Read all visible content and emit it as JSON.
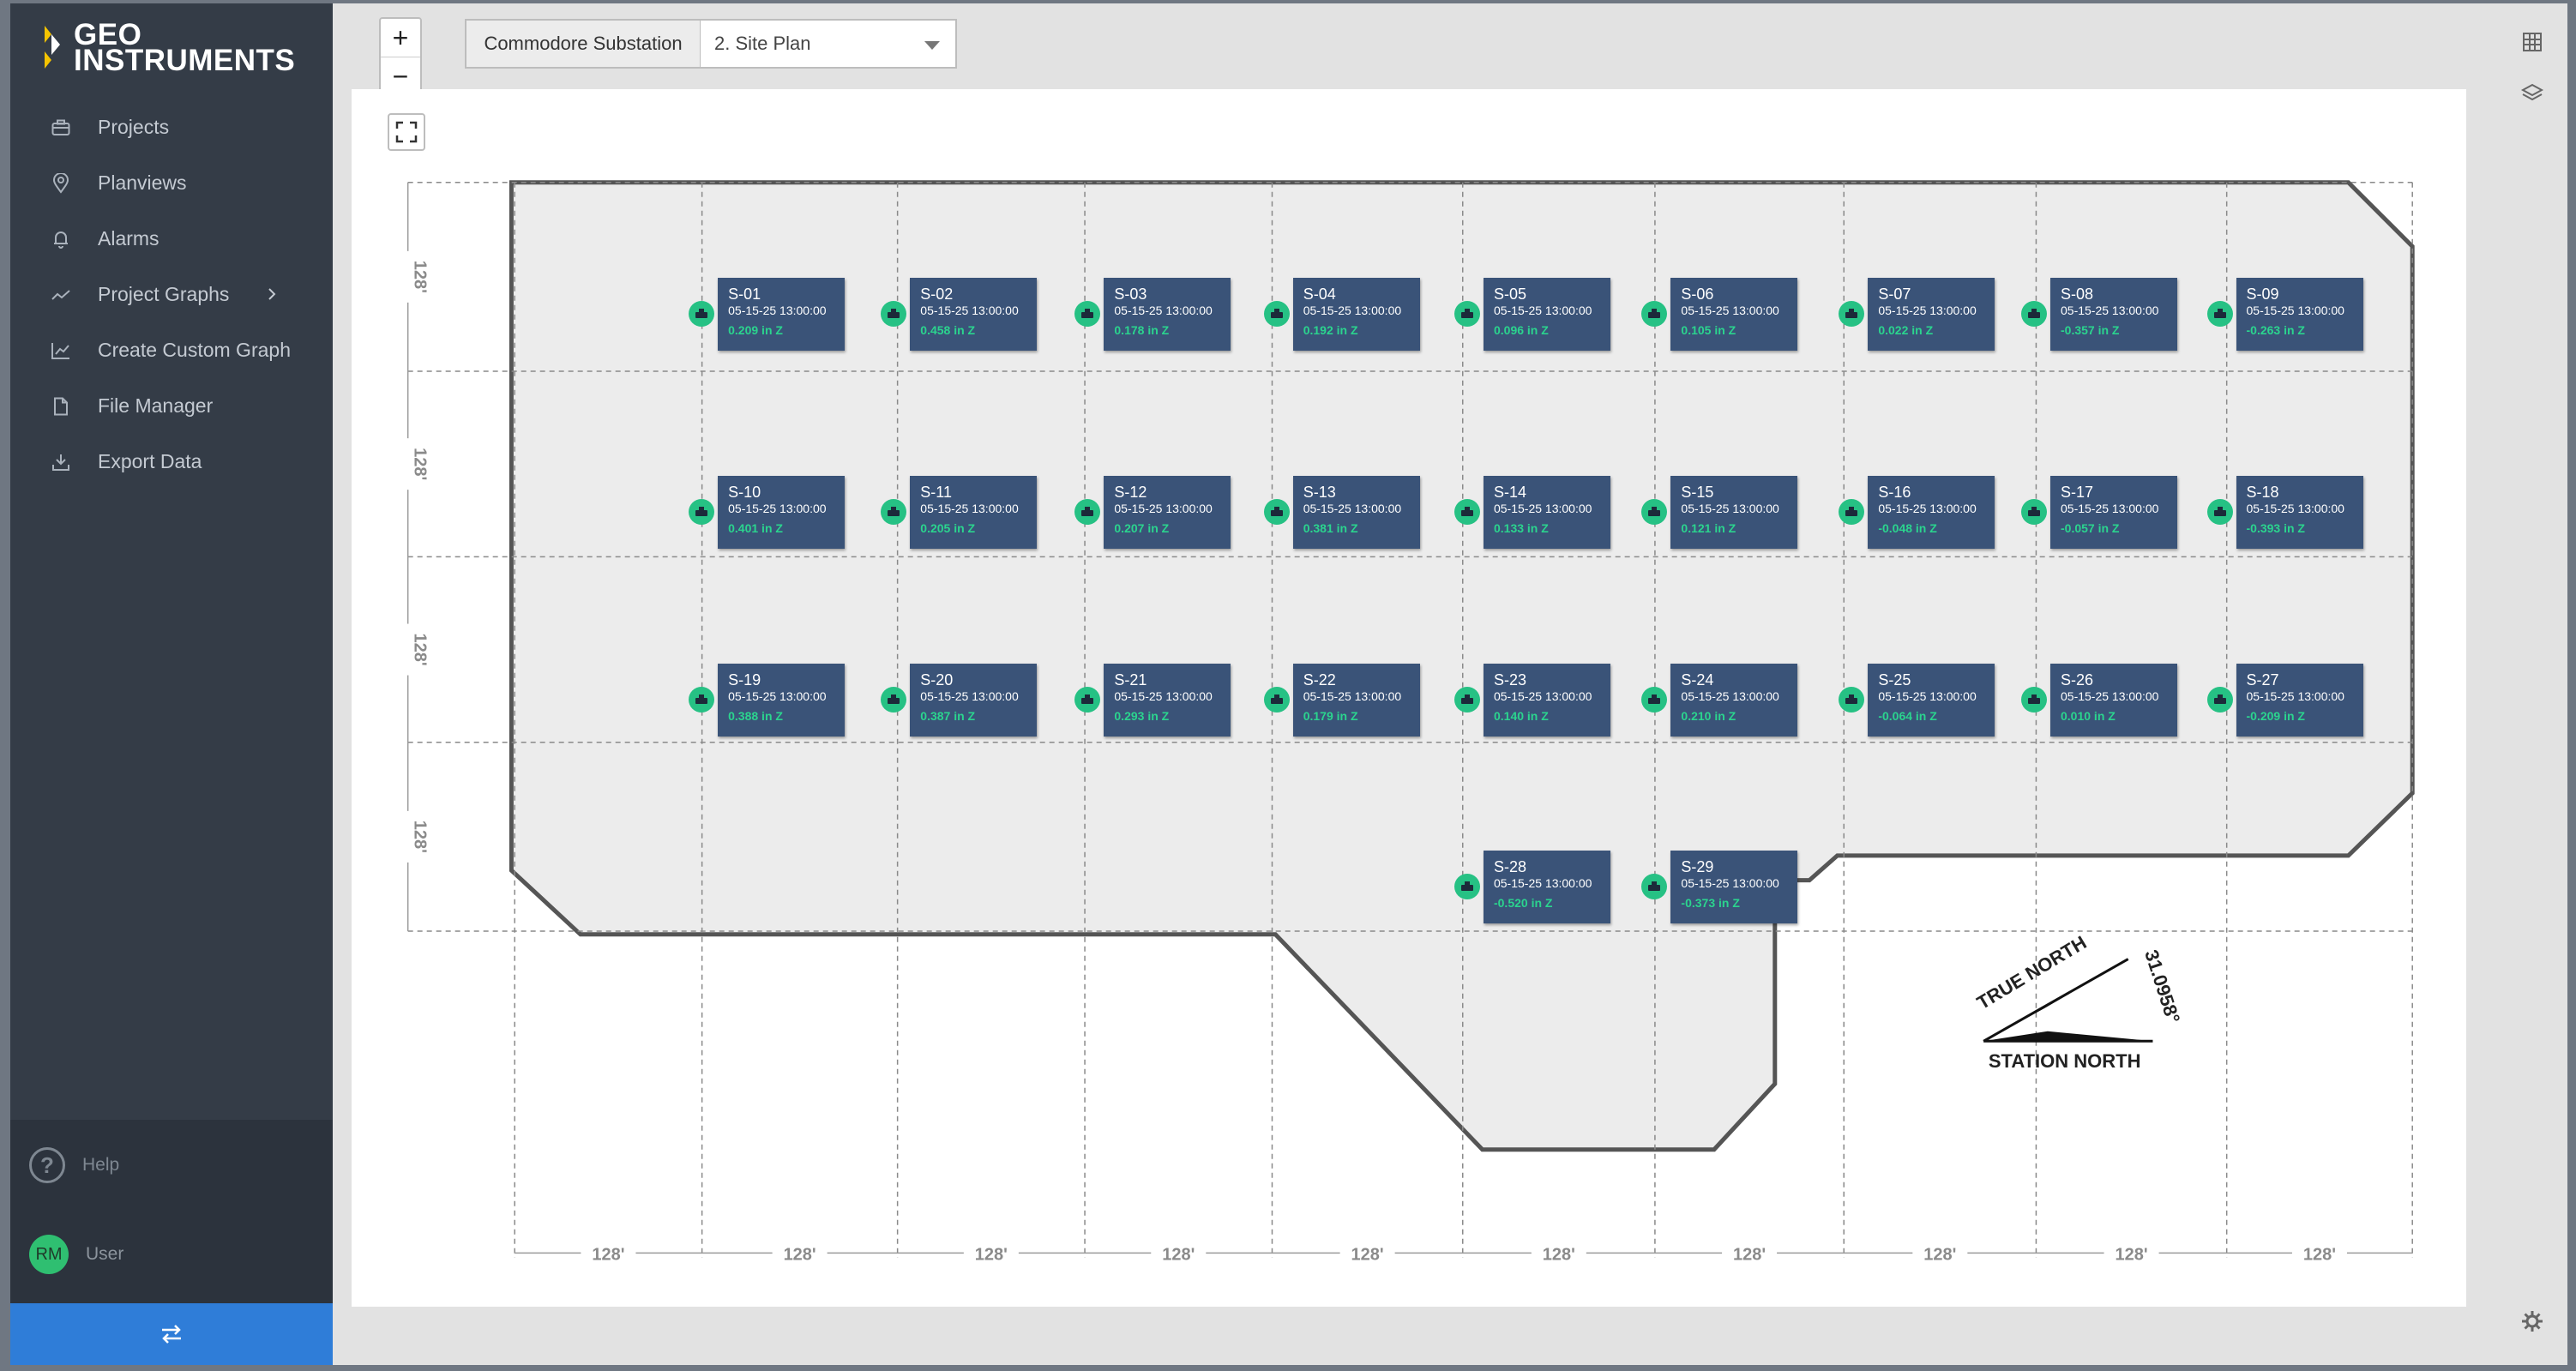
{
  "brand": {
    "line1": "GEO",
    "line2": "INSTRUMENTS",
    "accent": "#f5c400"
  },
  "nav": [
    {
      "label": "Projects",
      "icon": "briefcase-icon"
    },
    {
      "label": "Planviews",
      "icon": "map-pin-icon"
    },
    {
      "label": "Alarms",
      "icon": "bell-icon"
    },
    {
      "label": "Project Graphs",
      "icon": "line-chart-icon"
    },
    {
      "label": "Create Custom Graph",
      "icon": "area-chart-icon"
    },
    {
      "label": "File Manager",
      "icon": "file-icon"
    },
    {
      "label": "Export Data",
      "icon": "download-icon"
    }
  ],
  "help": {
    "glyph": "?",
    "label": "Help"
  },
  "user": {
    "initials": "RM",
    "label": "User"
  },
  "toolbar": {
    "zoom_in": "+",
    "zoom_out": "−",
    "project": "Commodore Substation",
    "plan": "2. Site Plan"
  },
  "plan": {
    "dim_vertical": "128'",
    "dim_horizontal": "128'",
    "true_north": "TRUE NORTH",
    "station_north": "STATION NORTH",
    "angle": "31.0958°"
  },
  "sensors": [
    {
      "name": "S-01",
      "time": "05-15-25 13:00:00",
      "value": "0.209 in Z"
    },
    {
      "name": "S-02",
      "time": "05-15-25 13:00:00",
      "value": "0.458 in Z"
    },
    {
      "name": "S-03",
      "time": "05-15-25 13:00:00",
      "value": "0.178 in Z"
    },
    {
      "name": "S-04",
      "time": "05-15-25 13:00:00",
      "value": "0.192 in Z"
    },
    {
      "name": "S-05",
      "time": "05-15-25 13:00:00",
      "value": "0.096 in Z"
    },
    {
      "name": "S-06",
      "time": "05-15-25 13:00:00",
      "value": "0.105 in Z"
    },
    {
      "name": "S-07",
      "time": "05-15-25 13:00:00",
      "value": "0.022 in Z"
    },
    {
      "name": "S-08",
      "time": "05-15-25 13:00:00",
      "value": "-0.357 in Z"
    },
    {
      "name": "S-09",
      "time": "05-15-25 13:00:00",
      "value": "-0.263 in Z"
    },
    {
      "name": "S-10",
      "time": "05-15-25 13:00:00",
      "value": "0.401 in Z"
    },
    {
      "name": "S-11",
      "time": "05-15-25 13:00:00",
      "value": "0.205 in Z"
    },
    {
      "name": "S-12",
      "time": "05-15-25 13:00:00",
      "value": "0.207 in Z"
    },
    {
      "name": "S-13",
      "time": "05-15-25 13:00:00",
      "value": "0.381 in Z"
    },
    {
      "name": "S-14",
      "time": "05-15-25 13:00:00",
      "value": "0.133 in Z"
    },
    {
      "name": "S-15",
      "time": "05-15-25 13:00:00",
      "value": "0.121 in Z"
    },
    {
      "name": "S-16",
      "time": "05-15-25 13:00:00",
      "value": "-0.048 in Z"
    },
    {
      "name": "S-17",
      "time": "05-15-25 13:00:00",
      "value": "-0.057 in Z"
    },
    {
      "name": "S-18",
      "time": "05-15-25 13:00:00",
      "value": "-0.393 in Z"
    },
    {
      "name": "S-19",
      "time": "05-15-25 13:00:00",
      "value": "0.388 in Z"
    },
    {
      "name": "S-20",
      "time": "05-15-25 13:00:00",
      "value": "0.387 in Z"
    },
    {
      "name": "S-21",
      "time": "05-15-25 13:00:00",
      "value": "0.293 in Z"
    },
    {
      "name": "S-22",
      "time": "05-15-25 13:00:00",
      "value": "0.179 in Z"
    },
    {
      "name": "S-23",
      "time": "05-15-25 13:00:00",
      "value": "0.140 in Z"
    },
    {
      "name": "S-24",
      "time": "05-15-25 13:00:00",
      "value": "0.210 in Z"
    },
    {
      "name": "S-25",
      "time": "05-15-25 13:00:00",
      "value": "-0.064 in Z"
    },
    {
      "name": "S-26",
      "time": "05-15-25 13:00:00",
      "value": "0.010 in Z"
    },
    {
      "name": "S-27",
      "time": "05-15-25 13:00:00",
      "value": "-0.209 in Z"
    },
    {
      "name": "S-28",
      "time": "05-15-25 13:00:00",
      "value": "-0.520 in Z"
    },
    {
      "name": "S-29",
      "time": "05-15-25 13:00:00",
      "value": "-0.373 in Z"
    }
  ]
}
